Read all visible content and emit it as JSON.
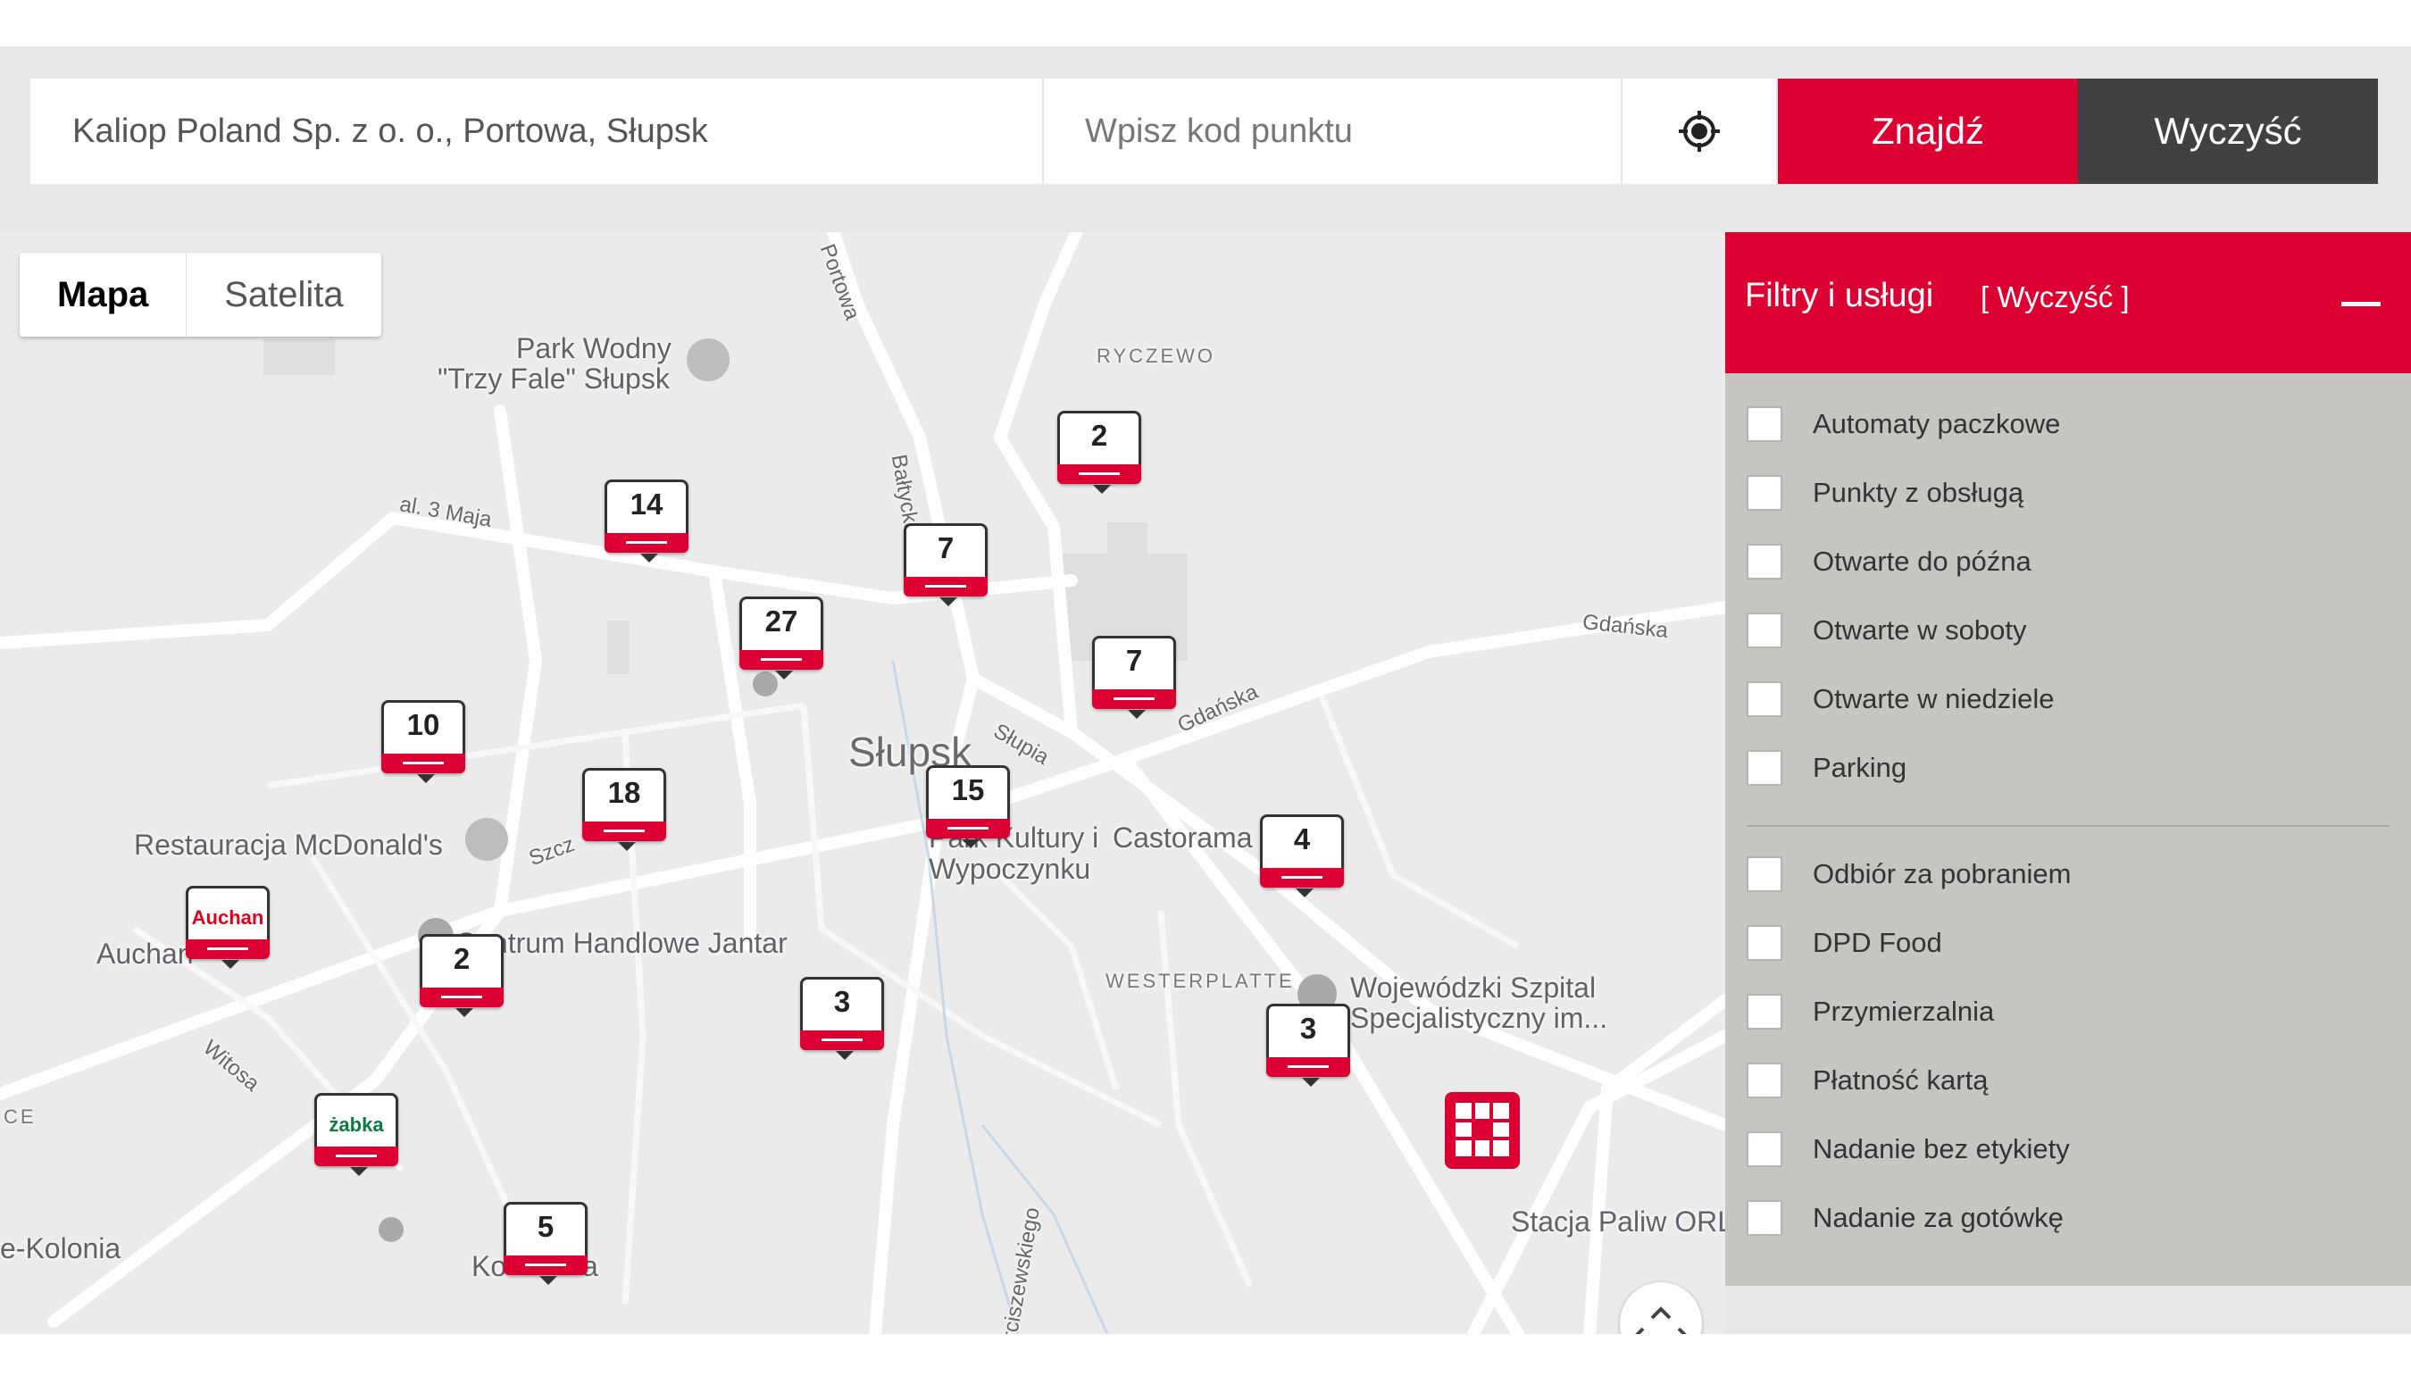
{
  "search": {
    "address_value": "Kaliop Poland Sp. z o. o., Portowa, Słupsk",
    "code_placeholder": "Wpisz kod punktu",
    "locate_icon": "crosshair-icon",
    "find_label": "Znajdź",
    "clear_label": "Wyczyść"
  },
  "map": {
    "type_toggle": {
      "map_label": "Mapa",
      "satellite_label": "Satelita",
      "selected": "Mapa"
    },
    "labels": {
      "park_wodny_1": "Park Wodny",
      "park_wodny_2": "\"Trzy Fale\" Słupsk",
      "ryczewo": "RYCZEWO",
      "portowa": "Portowa",
      "al3maja": "al. 3 Maja",
      "baltycka": "Bałtycka",
      "gdanska1": "Gdańska",
      "gdanska2": "Gdańska",
      "slupsk": "Słupsk",
      "slupia": "Słupia",
      "mcdonalds": "Restauracja McDonald's",
      "szcz": "Szcz",
      "park_kultury_1": "Park Kultury i",
      "park_kultury_2": "Wypoczynku",
      "castorama": "Castorama",
      "auchan": "Auchan",
      "jantar": "Centrum Handlowe Jantar",
      "westerplatte": "WESTERPLATTE",
      "szpital_1": "Wojewódzki Szpital",
      "szpital_2": "Specjalistyczny im...",
      "witosa": "Witosa",
      "ce": "CE",
      "kolonia": "e-Kolonia",
      "ko": "Ko",
      "a": "a",
      "arciszewskiego": "Arciszewskiego",
      "stacja": "Stacja Paliw ORL"
    },
    "markers": [
      {
        "count": "2"
      },
      {
        "count": "14"
      },
      {
        "count": "7"
      },
      {
        "count": "27"
      },
      {
        "count": "7"
      },
      {
        "count": "10"
      },
      {
        "count": "18"
      },
      {
        "count": "15"
      },
      {
        "count": "4"
      },
      {
        "count": "Auchan"
      },
      {
        "count": "2"
      },
      {
        "count": "3"
      },
      {
        "count": "3"
      },
      {
        "count": "żabka"
      },
      {
        "count": "5"
      }
    ],
    "accent": "#dc0032"
  },
  "filters": {
    "title": "Filtry i usługi",
    "clear": "[ Wyczyść ]",
    "group1": [
      "Automaty paczkowe",
      "Punkty z obsługą",
      "Otwarte do późna",
      "Otwarte w soboty",
      "Otwarte w niedziele",
      "Parking"
    ],
    "group2": [
      "Odbiór za pobraniem",
      "DPD Food",
      "Przymierzalnia",
      "Płatność kartą",
      "Nadanie bez etykiety",
      "Nadanie za gotówkę"
    ]
  }
}
